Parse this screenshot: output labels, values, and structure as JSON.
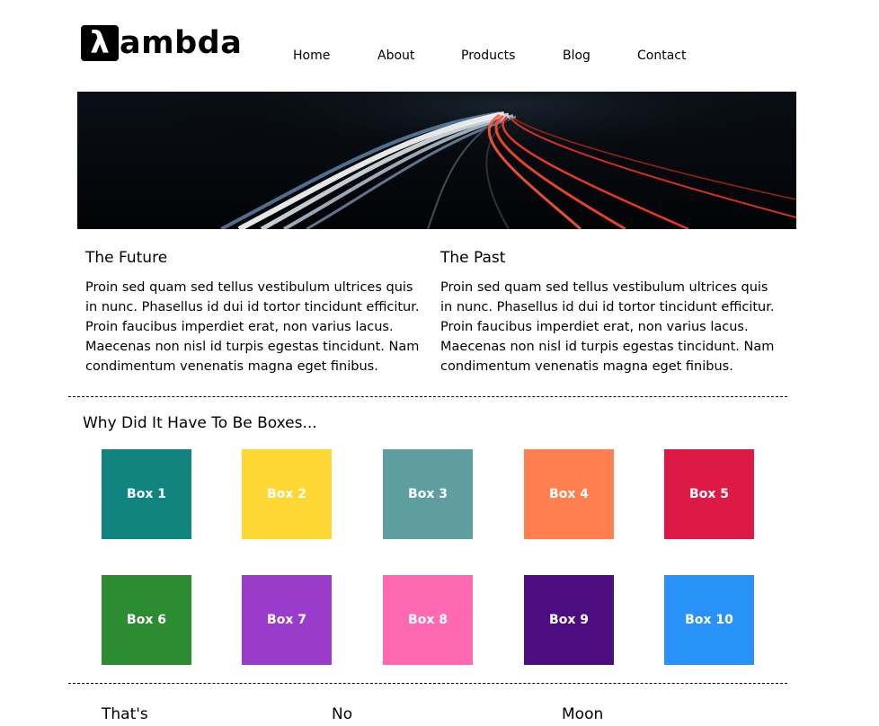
{
  "brand": {
    "logo_mark": "λ",
    "logo_text": "ambda"
  },
  "nav": {
    "items": [
      "Home",
      "About",
      "Products",
      "Blog",
      "Contact"
    ]
  },
  "hero": {
    "image": "night-highway-light-trails-photo"
  },
  "columns": [
    {
      "title": "The Future",
      "body": "Proin sed quam sed tellus vestibulum ultrices quis in nunc. Phasellus id dui id tortor tincidunt efficitur. Proin faucibus imperdiet erat, non varius lacus. Maecenas non nisl id turpis egestas tincidunt. Nam condimentum venenatis magna eget finibus."
    },
    {
      "title": "The Past",
      "body": "Proin sed quam sed tellus vestibulum ultrices quis in nunc. Phasellus id dui id tortor tincidunt efficitur. Proin faucibus imperdiet erat, non varius lacus. Maecenas non nisl id turpis egestas tincidunt. Nam condimentum venenatis magna eget finibus."
    }
  ],
  "boxes_section": {
    "title": "Why Did It Have To Be Boxes...",
    "boxes": [
      {
        "label": "Box 1",
        "color": "#12847f"
      },
      {
        "label": "Box 2",
        "color": "#fdd835"
      },
      {
        "label": "Box 3",
        "color": "#5f9ea0"
      },
      {
        "label": "Box 4",
        "color": "#ff7f50"
      },
      {
        "label": "Box 5",
        "color": "#dc1a45"
      },
      {
        "label": "Box 6",
        "color": "#2d8b31"
      },
      {
        "label": "Box 7",
        "color": "#993ccc"
      },
      {
        "label": "Box 8",
        "color": "#ff69b4"
      },
      {
        "label": "Box 9",
        "color": "#4b0d7f"
      },
      {
        "label": "Box 10",
        "color": "#2992f9"
      }
    ]
  },
  "footer": {
    "words": [
      "That's",
      "No",
      "Moon"
    ]
  }
}
